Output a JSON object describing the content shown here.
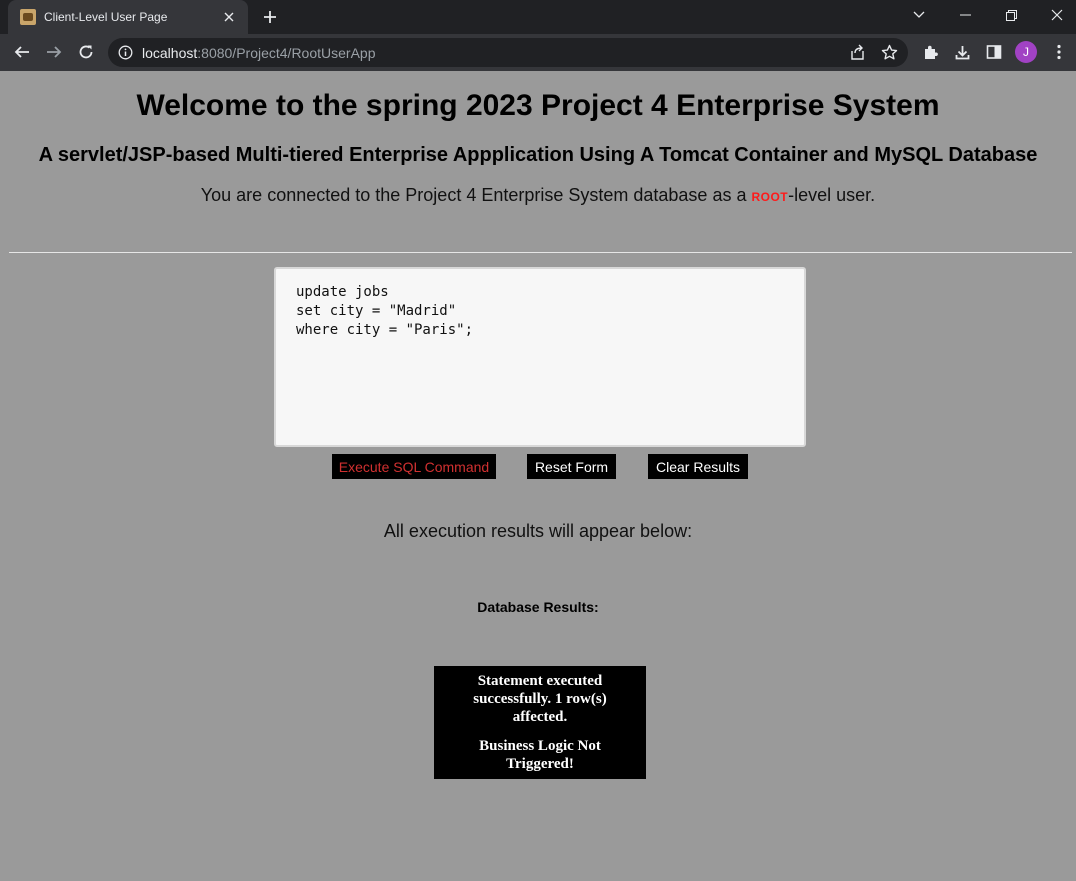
{
  "browser": {
    "tab_title": "Client-Level User Page",
    "url_host": "localhost",
    "url_rest": ":8080/Project4/RootUserApp",
    "profile_initial": "J"
  },
  "page": {
    "title": "Welcome to the spring 2023 Project 4 Enterprise System",
    "subtitle": "A servlet/JSP-based Multi-tiered Enterprise Appplication Using A Tomcat Container and MySQL Database",
    "connected_prefix": "You are connected to the Project 4 Enterprise System database as a ",
    "connected_role": "root",
    "connected_suffix": "-level user.",
    "sql_command": "update jobs\nset city = \"Madrid\"\nwhere city = \"Paris\";",
    "buttons": {
      "execute": "Execute SQL Command",
      "reset": "Reset Form",
      "clear": "Clear Results"
    },
    "results_note": "All execution results will appear below:",
    "db_results_label": "Database Results:",
    "result_messages": [
      "Statement executed successfully. 1 row(s) affected.",
      "Business Logic Not Triggered!"
    ]
  },
  "colors": {
    "page_background": "#9a9a9a",
    "root_highlight": "#ff1a1a",
    "execute_text": "#d03030",
    "profile_avatar": "#a142c4"
  }
}
